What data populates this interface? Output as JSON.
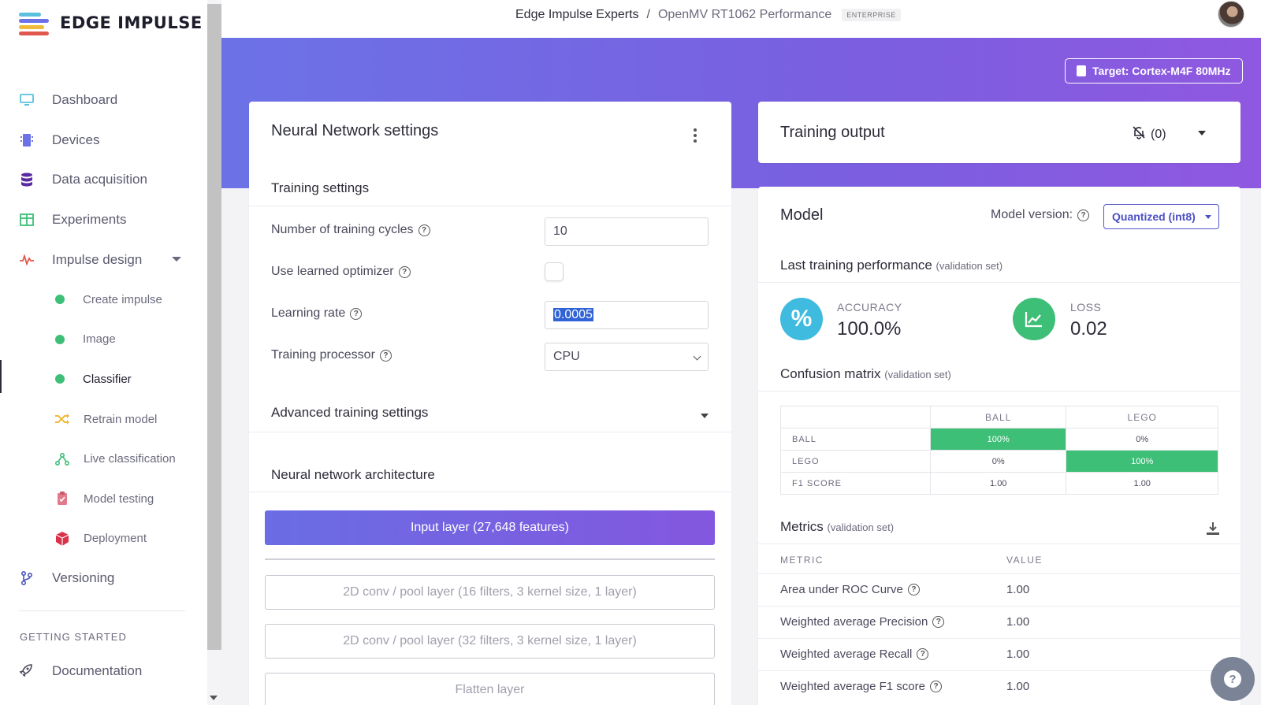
{
  "brand": {
    "name": "EDGE IMPULSE"
  },
  "sidebar": {
    "items": [
      {
        "label": "Dashboard",
        "icon": "monitor-icon",
        "color": "#5bc0de"
      },
      {
        "label": "Devices",
        "icon": "chip-icon",
        "color": "#6c72e6"
      },
      {
        "label": "Data acquisition",
        "icon": "database-icon",
        "color": "#5a2aa0"
      },
      {
        "label": "Experiments",
        "icon": "grid-icon",
        "color": "#3dbf78"
      },
      {
        "label": "Impulse design",
        "icon": "pulse-icon",
        "color": "#e0584d"
      }
    ],
    "sub_items": [
      {
        "label": "Create impulse"
      },
      {
        "label": "Image"
      },
      {
        "label": "Classifier"
      },
      {
        "label": "Retrain model",
        "icon": "shuffle-icon",
        "color": "#f0b93a"
      },
      {
        "label": "Live classification",
        "icon": "network-icon",
        "color": "#3dbf78"
      },
      {
        "label": "Model testing",
        "icon": "clipboard-check-icon",
        "color": "#e27a8c"
      },
      {
        "label": "Deployment",
        "icon": "cube-icon",
        "color": "#d9324b"
      }
    ],
    "versioning": {
      "label": "Versioning"
    },
    "section_title": "GETTING STARTED",
    "documentation": {
      "label": "Documentation"
    }
  },
  "header": {
    "org": "Edge Impulse Experts",
    "separator": "/",
    "project": "OpenMV RT1062 Performance",
    "badge": "ENTERPRISE"
  },
  "target": {
    "label": "Target: Cortex-M4F 80MHz"
  },
  "nn_settings": {
    "title": "Neural Network settings",
    "training_settings_title": "Training settings",
    "fields": {
      "cycles_label": "Number of training cycles",
      "cycles_value": "10",
      "optimizer_label": "Use learned optimizer",
      "lr_label": "Learning rate",
      "lr_value": "0.0005",
      "processor_label": "Training processor",
      "processor_value": "CPU"
    },
    "advanced_title": "Advanced training settings",
    "architecture_title": "Neural network architecture",
    "layers": {
      "input": "Input layer (27,648 features)",
      "conv1": "2D conv / pool layer (16 filters, 3 kernel size, 1 layer)",
      "conv2": "2D conv / pool layer (32 filters, 3 kernel size, 1 layer)",
      "flatten": "Flatten layer"
    }
  },
  "training_output": {
    "title": "Training output",
    "notifications": "(0)"
  },
  "model": {
    "title": "Model",
    "version_label": "Model version:",
    "version_value": "Quantized (int8)",
    "last_perf_title": "Last training performance",
    "validation_suffix": "(validation set)",
    "accuracy": {
      "label": "ACCURACY",
      "value": "100.0%",
      "icon": "percent-icon",
      "color": "#3fbbe0"
    },
    "loss": {
      "label": "LOSS",
      "value": "0.02",
      "icon": "chart-icon",
      "color": "#3dbf78"
    },
    "confusion_title": "Confusion matrix",
    "confusion": {
      "columns": [
        "BALL",
        "LEGO"
      ],
      "rows": [
        {
          "label": "BALL",
          "cells": [
            "100%",
            "0%"
          ]
        },
        {
          "label": "LEGO",
          "cells": [
            "0%",
            "100%"
          ]
        },
        {
          "label": "F1 SCORE",
          "cells": [
            "1.00",
            "1.00"
          ]
        }
      ]
    },
    "metrics_title": "Metrics",
    "metrics_headers": {
      "metric": "METRIC",
      "value": "VALUE"
    },
    "metrics": [
      {
        "label": "Area under ROC Curve",
        "value": "1.00"
      },
      {
        "label": "Weighted average Precision",
        "value": "1.00"
      },
      {
        "label": "Weighted average Recall",
        "value": "1.00"
      },
      {
        "label": "Weighted average F1 score",
        "value": "1.00"
      }
    ]
  },
  "help_fab": {
    "icon": "help-icon"
  }
}
